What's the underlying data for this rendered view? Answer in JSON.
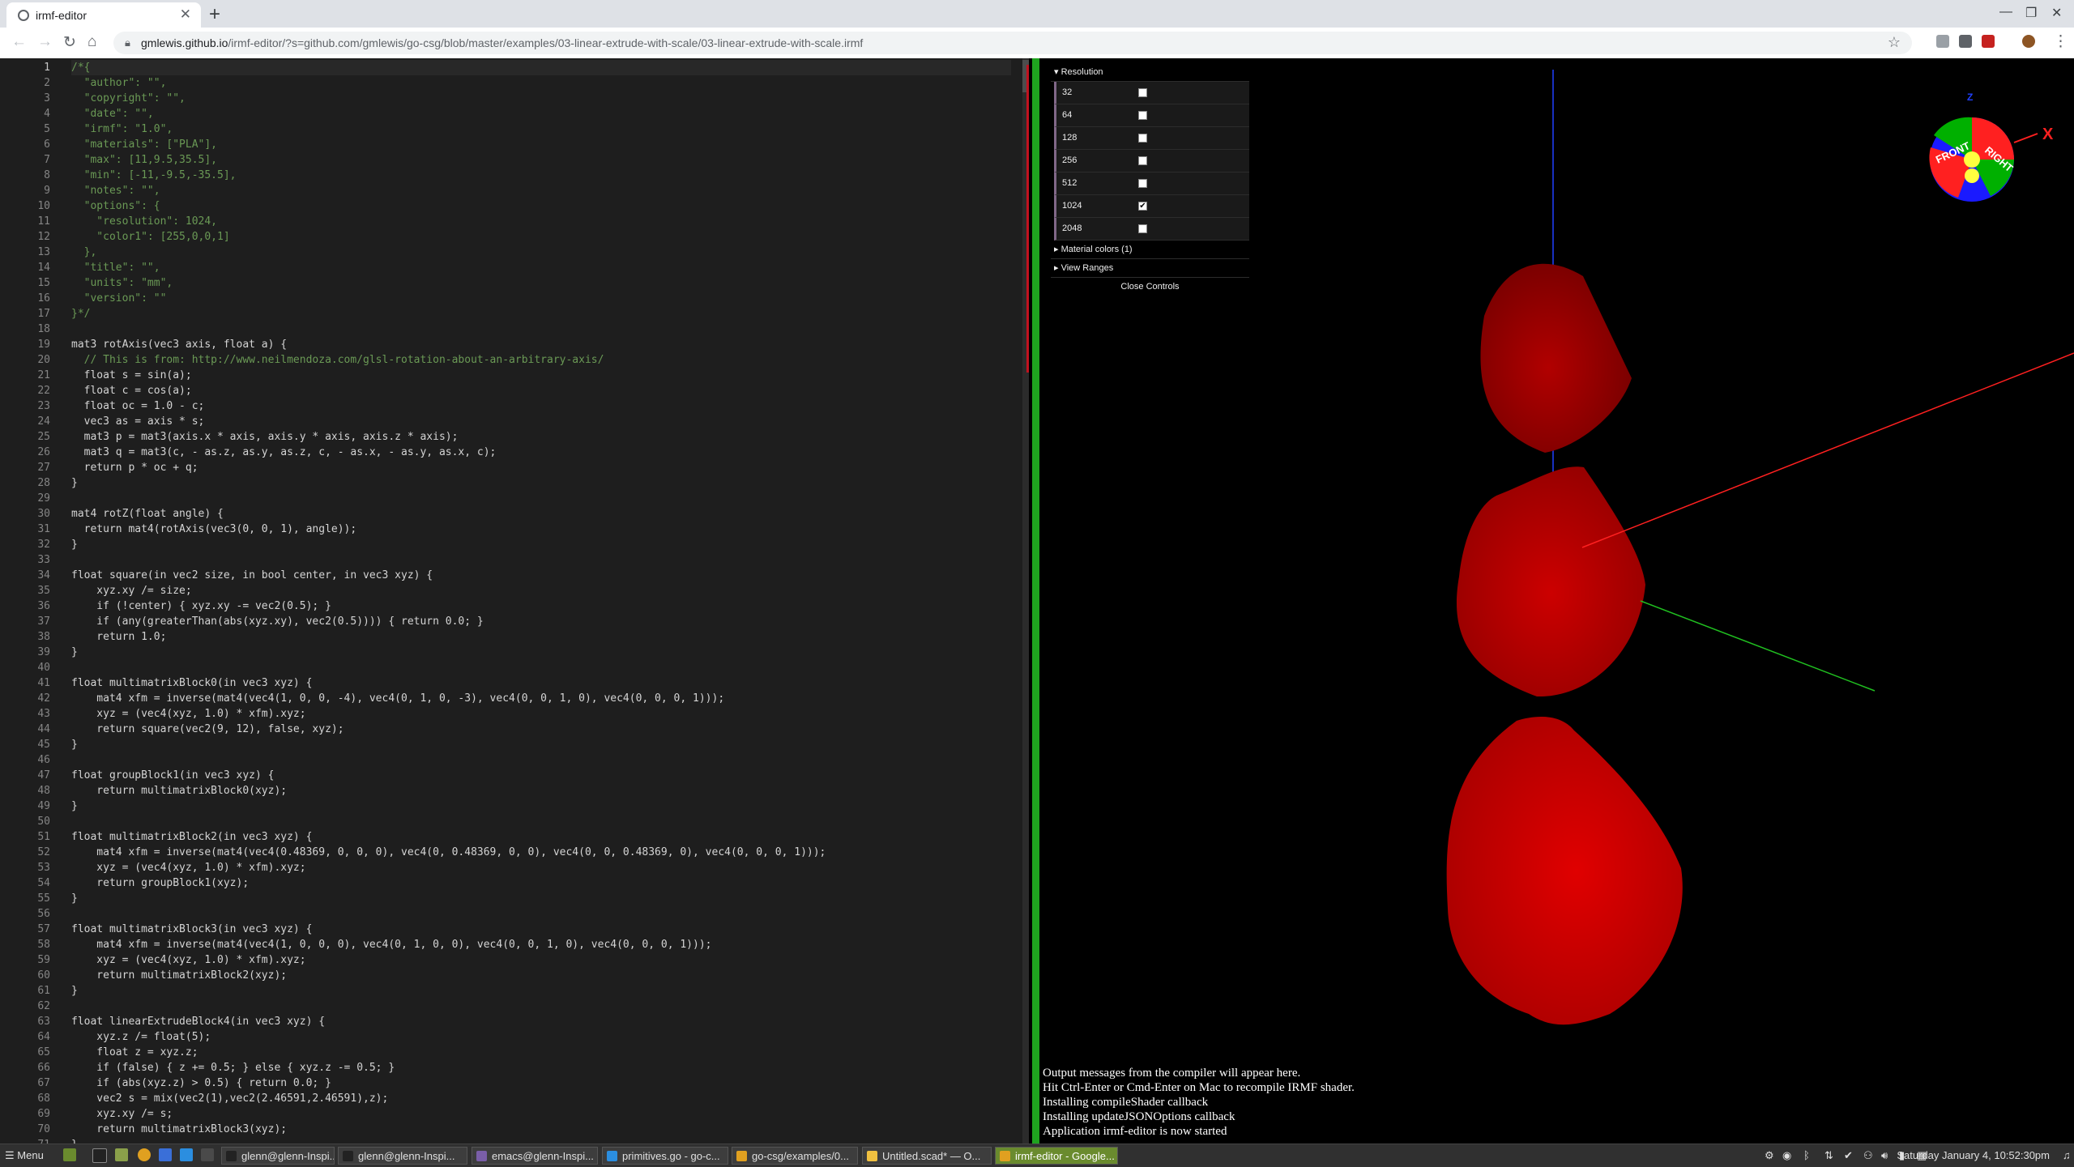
{
  "browser": {
    "tab_title": "irmf-editor",
    "url_host": "gmlewis.github.io",
    "url_path": "/irmf-editor/?s=github.com/gmlewis/go-csg/blob/master/examples/03-linear-extrude-with-scale/03-linear-extrude-with-scale.irmf"
  },
  "editor": {
    "lines": [
      {
        "n": 1,
        "t": "/*{",
        "c": "cm"
      },
      {
        "n": 2,
        "t": "  \"author\": \"\",",
        "c": "cm"
      },
      {
        "n": 3,
        "t": "  \"copyright\": \"\",",
        "c": "cm"
      },
      {
        "n": 4,
        "t": "  \"date\": \"\",",
        "c": "cm"
      },
      {
        "n": 5,
        "t": "  \"irmf\": \"1.0\",",
        "c": "cm"
      },
      {
        "n": 6,
        "t": "  \"materials\": [\"PLA\"],",
        "c": "cm"
      },
      {
        "n": 7,
        "t": "  \"max\": [11,9.5,35.5],",
        "c": "cm"
      },
      {
        "n": 8,
        "t": "  \"min\": [-11,-9.5,-35.5],",
        "c": "cm"
      },
      {
        "n": 9,
        "t": "  \"notes\": \"\",",
        "c": "cm"
      },
      {
        "n": 10,
        "t": "  \"options\": {",
        "c": "cm"
      },
      {
        "n": 11,
        "t": "    \"resolution\": 1024,",
        "c": "cm"
      },
      {
        "n": 12,
        "t": "    \"color1\": [255,0,0,1]",
        "c": "cm"
      },
      {
        "n": 13,
        "t": "  },",
        "c": "cm"
      },
      {
        "n": 14,
        "t": "  \"title\": \"\",",
        "c": "cm"
      },
      {
        "n": 15,
        "t": "  \"units\": \"mm\",",
        "c": "cm"
      },
      {
        "n": 16,
        "t": "  \"version\": \"\"",
        "c": "cm"
      },
      {
        "n": 17,
        "t": "}*/",
        "c": "cm"
      },
      {
        "n": 18,
        "t": "",
        "c": ""
      },
      {
        "n": 19,
        "t": "mat3 rotAxis(vec3 axis, float a) {",
        "c": ""
      },
      {
        "n": 20,
        "t": "  // This is from: http://www.neilmendoza.com/glsl-rotation-about-an-arbitrary-axis/",
        "c": "cm"
      },
      {
        "n": 21,
        "t": "  float s = sin(a);",
        "c": ""
      },
      {
        "n": 22,
        "t": "  float c = cos(a);",
        "c": ""
      },
      {
        "n": 23,
        "t": "  float oc = 1.0 - c;",
        "c": ""
      },
      {
        "n": 24,
        "t": "  vec3 as = axis * s;",
        "c": ""
      },
      {
        "n": 25,
        "t": "  mat3 p = mat3(axis.x * axis, axis.y * axis, axis.z * axis);",
        "c": ""
      },
      {
        "n": 26,
        "t": "  mat3 q = mat3(c, - as.z, as.y, as.z, c, - as.x, - as.y, as.x, c);",
        "c": ""
      },
      {
        "n": 27,
        "t": "  return p * oc + q;",
        "c": ""
      },
      {
        "n": 28,
        "t": "}",
        "c": ""
      },
      {
        "n": 29,
        "t": "",
        "c": ""
      },
      {
        "n": 30,
        "t": "mat4 rotZ(float angle) {",
        "c": ""
      },
      {
        "n": 31,
        "t": "  return mat4(rotAxis(vec3(0, 0, 1), angle));",
        "c": ""
      },
      {
        "n": 32,
        "t": "}",
        "c": ""
      },
      {
        "n": 33,
        "t": "",
        "c": ""
      },
      {
        "n": 34,
        "t": "float square(in vec2 size, in bool center, in vec3 xyz) {",
        "c": ""
      },
      {
        "n": 35,
        "t": "    xyz.xy /= size;",
        "c": ""
      },
      {
        "n": 36,
        "t": "    if (!center) { xyz.xy -= vec2(0.5); }",
        "c": ""
      },
      {
        "n": 37,
        "t": "    if (any(greaterThan(abs(xyz.xy), vec2(0.5)))) { return 0.0; }",
        "c": ""
      },
      {
        "n": 38,
        "t": "    return 1.0;",
        "c": ""
      },
      {
        "n": 39,
        "t": "}",
        "c": ""
      },
      {
        "n": 40,
        "t": "",
        "c": ""
      },
      {
        "n": 41,
        "t": "float multimatrixBlock0(in vec3 xyz) {",
        "c": ""
      },
      {
        "n": 42,
        "t": "    mat4 xfm = inverse(mat4(vec4(1, 0, 0, -4), vec4(0, 1, 0, -3), vec4(0, 0, 1, 0), vec4(0, 0, 0, 1)));",
        "c": ""
      },
      {
        "n": 43,
        "t": "    xyz = (vec4(xyz, 1.0) * xfm).xyz;",
        "c": ""
      },
      {
        "n": 44,
        "t": "    return square(vec2(9, 12), false, xyz);",
        "c": ""
      },
      {
        "n": 45,
        "t": "}",
        "c": ""
      },
      {
        "n": 46,
        "t": "",
        "c": ""
      },
      {
        "n": 47,
        "t": "float groupBlock1(in vec3 xyz) {",
        "c": ""
      },
      {
        "n": 48,
        "t": "    return multimatrixBlock0(xyz);",
        "c": ""
      },
      {
        "n": 49,
        "t": "}",
        "c": ""
      },
      {
        "n": 50,
        "t": "",
        "c": ""
      },
      {
        "n": 51,
        "t": "float multimatrixBlock2(in vec3 xyz) {",
        "c": ""
      },
      {
        "n": 52,
        "t": "    mat4 xfm = inverse(mat4(vec4(0.48369, 0, 0, 0), vec4(0, 0.48369, 0, 0), vec4(0, 0, 0.48369, 0), vec4(0, 0, 0, 1)));",
        "c": ""
      },
      {
        "n": 53,
        "t": "    xyz = (vec4(xyz, 1.0) * xfm).xyz;",
        "c": ""
      },
      {
        "n": 54,
        "t": "    return groupBlock1(xyz);",
        "c": ""
      },
      {
        "n": 55,
        "t": "}",
        "c": ""
      },
      {
        "n": 56,
        "t": "",
        "c": ""
      },
      {
        "n": 57,
        "t": "float multimatrixBlock3(in vec3 xyz) {",
        "c": ""
      },
      {
        "n": 58,
        "t": "    mat4 xfm = inverse(mat4(vec4(1, 0, 0, 0), vec4(0, 1, 0, 0), vec4(0, 0, 1, 0), vec4(0, 0, 0, 1)));",
        "c": ""
      },
      {
        "n": 59,
        "t": "    xyz = (vec4(xyz, 1.0) * xfm).xyz;",
        "c": ""
      },
      {
        "n": 60,
        "t": "    return multimatrixBlock2(xyz);",
        "c": ""
      },
      {
        "n": 61,
        "t": "}",
        "c": ""
      },
      {
        "n": 62,
        "t": "",
        "c": ""
      },
      {
        "n": 63,
        "t": "float linearExtrudeBlock4(in vec3 xyz) {",
        "c": ""
      },
      {
        "n": 64,
        "t": "    xyz.z /= float(5);",
        "c": ""
      },
      {
        "n": 65,
        "t": "    float z = xyz.z;",
        "c": ""
      },
      {
        "n": 66,
        "t": "    if (false) { z += 0.5; } else { xyz.z -= 0.5; }",
        "c": ""
      },
      {
        "n": 67,
        "t": "    if (abs(xyz.z) > 0.5) { return 0.0; }",
        "c": ""
      },
      {
        "n": 68,
        "t": "    vec2 s = mix(vec2(1),vec2(2.46591,2.46591),z);",
        "c": ""
      },
      {
        "n": 69,
        "t": "    xyz.xy /= s;",
        "c": ""
      },
      {
        "n": 70,
        "t": "    return multimatrixBlock3(xyz);",
        "c": ""
      },
      {
        "n": 71,
        "t": "}",
        "c": ""
      }
    ]
  },
  "controls": {
    "resolution_title": "Resolution",
    "resolutions": [
      {
        "label": "32",
        "checked": false
      },
      {
        "label": "64",
        "checked": false
      },
      {
        "label": "128",
        "checked": false
      },
      {
        "label": "256",
        "checked": false
      },
      {
        "label": "512",
        "checked": false
      },
      {
        "label": "1024",
        "checked": true
      },
      {
        "label": "2048",
        "checked": false
      }
    ],
    "material_colors": "Material colors (1)",
    "view_ranges": "View Ranges",
    "close_controls": "Close Controls"
  },
  "gizmo": {
    "front": "FRONT",
    "right": "RIGHT",
    "x_label": "X",
    "z_label": "Z"
  },
  "console": {
    "messages": [
      "Output messages from the compiler will appear here.",
      "Hit Ctrl-Enter or Cmd-Enter on Mac to recompile IRMF shader.",
      "Installing compileShader callback",
      "Installing updateJSONOptions callback",
      "Application irmf-editor is now started"
    ]
  },
  "taskbar": {
    "menu": "Menu",
    "items": [
      {
        "label": "glenn@glenn-Inspi...",
        "icon": "terminal-icon",
        "color": "#222222",
        "active": false
      },
      {
        "label": "glenn@glenn-Inspi...",
        "icon": "terminal-icon",
        "color": "#222222",
        "active": false
      },
      {
        "label": "emacs@glenn-Inspi...",
        "icon": "emacs-icon",
        "color": "#7a5ea8",
        "active": false
      },
      {
        "label": "primitives.go - go-c...",
        "icon": "vscode-icon",
        "color": "#2b8ee0",
        "active": false
      },
      {
        "label": "go-csg/examples/0...",
        "icon": "chrome-icon",
        "color": "#e0a020",
        "active": false
      },
      {
        "label": "Untitled.scad* — O...",
        "icon": "openscad-icon",
        "color": "#f0c040",
        "active": false
      },
      {
        "label": "irmf-editor - Google...",
        "icon": "chrome-icon",
        "color": "#e0a020",
        "active": true
      }
    ],
    "clock": "Saturday January 4, 10:52:30pm"
  },
  "colors": {
    "shape_red": "#c00000",
    "axis_x": "#ff2020",
    "axis_y": "#20c020",
    "axis_z": "#2040ff",
    "divider_green": "#1fa31f"
  }
}
